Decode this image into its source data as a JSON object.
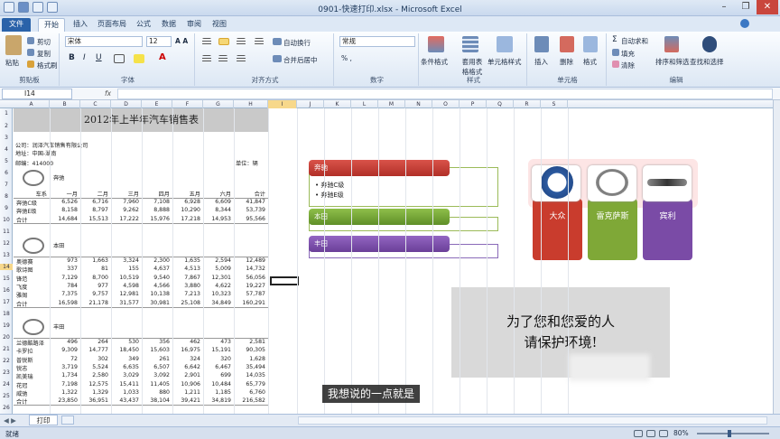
{
  "window": {
    "title": "0901-快速打印.xlsx - Microsoft Excel"
  },
  "tabs": [
    "文件",
    "开始",
    "插入",
    "页面布局",
    "公式",
    "数据",
    "审阅",
    "视图"
  ],
  "ribbon": {
    "clipboard": {
      "paste": "粘贴",
      "cut": "剪切",
      "copy": "复制",
      "format_painter": "格式刷",
      "label": "剪贴板"
    },
    "font": {
      "name": "宋体",
      "size": "12",
      "label": "字体"
    },
    "alignment": {
      "wrap": "自动换行",
      "merge": "合并后居中",
      "label": "对齐方式"
    },
    "number": {
      "format": "常规",
      "label": "数字"
    },
    "styles": {
      "conditional": "条件格式",
      "table": "套用表格格式",
      "cell_style": "单元格样式",
      "label": "样式"
    },
    "cells": {
      "insert": "插入",
      "delete": "删除",
      "format": "格式",
      "label": "单元格"
    },
    "editing": {
      "autosum": "自动求和",
      "fill": "填充",
      "clear": "清除",
      "sort": "排序和筛选",
      "find": "查找和选择",
      "label": "编辑"
    }
  },
  "formula_bar": {
    "name_box": "I14",
    "fx": "fx",
    "value": ""
  },
  "columns": [
    "A",
    "B",
    "C",
    "D",
    "E",
    "F",
    "G",
    "H",
    "I",
    "J",
    "K",
    "L",
    "M",
    "N",
    "O",
    "P",
    "Q",
    "R",
    "S"
  ],
  "sheet": {
    "title": "2012年上半年汽车销售表",
    "company": "公司：润泽汽车销售有限公司",
    "address": "地址：中国-湖南",
    "postcode": "邮编：414000",
    "unit": "单位：辆",
    "brands": [
      {
        "name": "奔驰",
        "header": [
          "车系",
          "一月",
          "二月",
          "三月",
          "四月",
          "五月",
          "六月",
          "合计"
        ],
        "rows": [
          [
            "奔驰C级",
            "6,526",
            "6,716",
            "7,960",
            "7,108",
            "6,928",
            "6,609",
            "41,847"
          ],
          [
            "奔驰E级",
            "8,158",
            "8,797",
            "9,262",
            "8,888",
            "10,290",
            "8,344",
            "53,739"
          ],
          [
            "合计",
            "14,684",
            "15,513",
            "17,222",
            "15,976",
            "17,218",
            "14,953",
            "95,566"
          ]
        ]
      },
      {
        "name": "本田",
        "rows": [
          [
            "奥德赛",
            "973",
            "1,663",
            "3,324",
            "2,300",
            "1,635",
            "2,594",
            "12,489"
          ],
          [
            "歌诗图",
            "337",
            "81",
            "155",
            "4,637",
            "4,513",
            "5,009",
            "14,732"
          ],
          [
            "锋范",
            "7,129",
            "8,700",
            "10,519",
            "9,540",
            "7,867",
            "12,301",
            "56,056"
          ],
          [
            "飞度",
            "784",
            "977",
            "4,598",
            "4,566",
            "3,880",
            "4,622",
            "19,227"
          ],
          [
            "雅阁",
            "7,375",
            "9,757",
            "12,981",
            "10,138",
            "7,213",
            "10,323",
            "57,787"
          ],
          [
            "合计",
            "16,598",
            "21,178",
            "31,577",
            "30,981",
            "25,108",
            "34,849",
            "160,291"
          ]
        ]
      },
      {
        "name": "丰田",
        "rows": [
          [
            "兰德酷路泽",
            "496",
            "264",
            "530",
            "356",
            "462",
            "473",
            "2,581"
          ],
          [
            "卡罗拉",
            "9,309",
            "14,777",
            "18,450",
            "15,603",
            "16,975",
            "15,191",
            "90,305"
          ],
          [
            "普锐斯",
            "72",
            "302",
            "349",
            "261",
            "324",
            "320",
            "1,628"
          ],
          [
            "锐志",
            "3,719",
            "5,524",
            "6,635",
            "6,507",
            "6,642",
            "6,467",
            "35,494"
          ],
          [
            "凯美瑞",
            "1,734",
            "2,580",
            "3,029",
            "3,092",
            "2,901",
            "699",
            "14,035"
          ],
          [
            "花冠",
            "7,198",
            "12,575",
            "15,411",
            "11,405",
            "10,906",
            "10,484",
            "65,779"
          ],
          [
            "威驰",
            "1,322",
            "1,329",
            "1,033",
            "880",
            "1,211",
            "1,185",
            "6,760"
          ],
          [
            "合计",
            "23,850",
            "36,951",
            "43,437",
            "38,104",
            "39,421",
            "34,819",
            "216,582"
          ]
        ]
      }
    ]
  },
  "smartart": {
    "items": [
      {
        "title": "奔驰",
        "sub": [
          "奔驰C级",
          "奔驰E级"
        ],
        "color": "#c0392b"
      },
      {
        "title": "本田",
        "sub": [],
        "color": "#77a33a"
      },
      {
        "title": "丰田",
        "sub": [],
        "color": "#7d4ca8"
      }
    ]
  },
  "picture_blocks": [
    {
      "label": "大众",
      "color": "#c93c2d"
    },
    {
      "label": "雷克萨斯",
      "color": "#7fa837"
    },
    {
      "label": "宾利",
      "color": "#7a4ba6"
    }
  ],
  "notice": {
    "line1": "为了您和您爱的人",
    "line2": "请保护环境!"
  },
  "subtitle": "我想说的一点就是",
  "sheet_tab": "打印",
  "status": {
    "ready": "就绪",
    "zoom": "80%"
  }
}
